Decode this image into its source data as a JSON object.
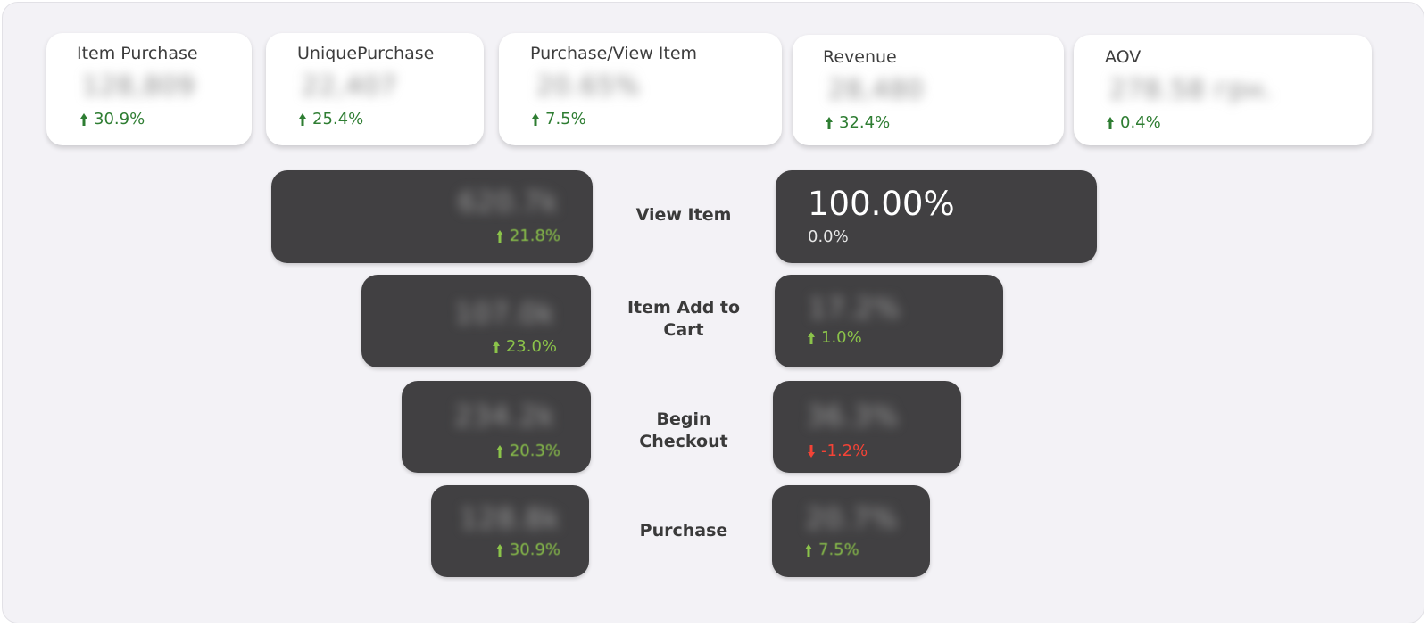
{
  "colors": {
    "up_card": "#2e7d32",
    "up_bar": "#8bc34a",
    "down": "#f44336",
    "bar_bg": "#414042"
  },
  "kpis": [
    {
      "label": "Item Purchase",
      "value": "128,809",
      "delta": "30.9%",
      "icon": "arrow-up-icon"
    },
    {
      "label": "UniquePurchase",
      "value": "22,407",
      "delta": "25.4%",
      "icon": "arrow-up-icon"
    },
    {
      "label": "Purchase/View Item",
      "value": "20.65%",
      "delta": "7.5%",
      "icon": "arrow-up-icon"
    },
    {
      "label": "Revenue",
      "value": "28,480",
      "delta": "32.4%",
      "icon": "arrow-up-icon"
    },
    {
      "label": "AOV",
      "value": "278.58 грн.",
      "delta": "0.4%",
      "icon": "arrow-up-icon"
    }
  ],
  "funnel": [
    {
      "stage": "View Item",
      "left": {
        "value": "620.7k",
        "delta": "21.8%",
        "trend": "up"
      },
      "right": {
        "value": "100.00%",
        "delta": "0.0%",
        "trend": "neutral"
      }
    },
    {
      "stage": "Item Add to Cart",
      "left": {
        "value": "107.0k",
        "delta": "23.0%",
        "trend": "up"
      },
      "right": {
        "value": "17.2%",
        "delta": "1.0%",
        "trend": "up"
      }
    },
    {
      "stage": "Begin Checkout",
      "left": {
        "value": "234.2k",
        "delta": "20.3%",
        "trend": "up"
      },
      "right": {
        "value": "36.3%",
        "delta": "-1.2%",
        "trend": "down"
      }
    },
    {
      "stage": "Purchase",
      "left": {
        "value": "128.8k",
        "delta": "30.9%",
        "trend": "up"
      },
      "right": {
        "value": "20.7%",
        "delta": "7.5%",
        "trend": "up"
      }
    }
  ]
}
